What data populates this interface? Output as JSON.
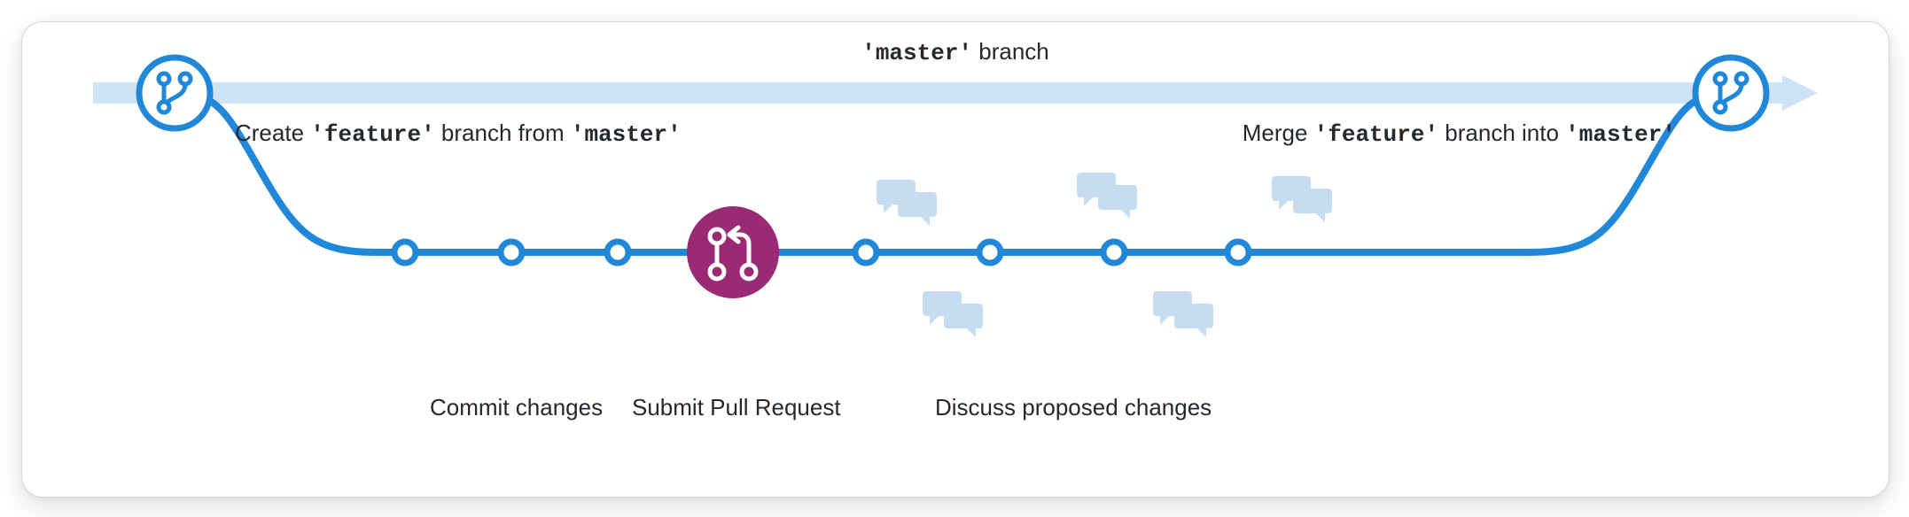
{
  "top": {
    "master_literal": "'master'",
    "branch_word": " branch"
  },
  "create": {
    "prefix": "Create ",
    "feature_literal": "'feature'",
    "middle": " branch from ",
    "master_literal": "'master'"
  },
  "merge": {
    "prefix": "Merge ",
    "feature_literal": "'feature'",
    "middle": " branch into ",
    "master_literal": "'master'"
  },
  "bottom": {
    "commit": "Commit changes",
    "submit": "Submit Pull Request",
    "discuss": "Discuss proposed changes"
  },
  "colors": {
    "blue": "#2188d9",
    "blue_light": "#cfe3f6",
    "purple": "#9b2a76",
    "chat": "#c6dcf0"
  }
}
